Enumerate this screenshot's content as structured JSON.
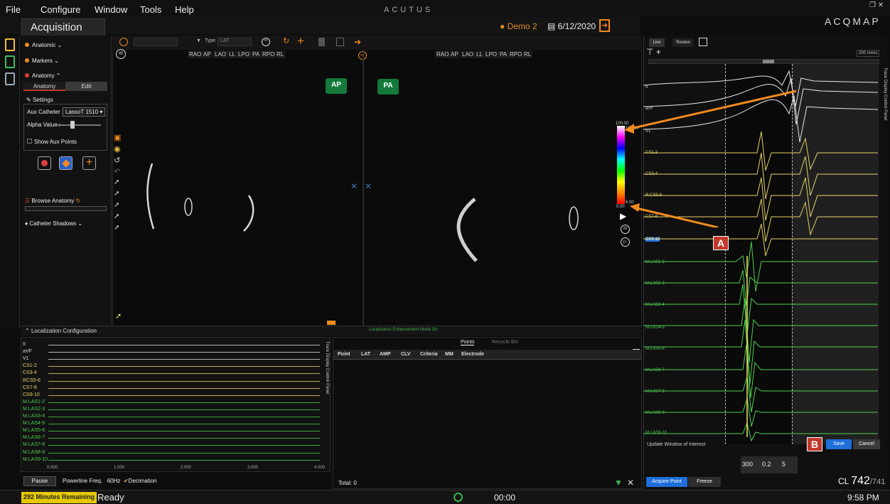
{
  "menu": {
    "items": [
      "File",
      "Configure",
      "Window",
      "Tools",
      "Help"
    ]
  },
  "brand": {
    "center": "ACUTUS",
    "right": "ACQMAP"
  },
  "window_controls": "❐ ✕",
  "header": {
    "mode_tab": "Acquisition",
    "user": "Demo 2",
    "date": "6/12/2020"
  },
  "left_panel": {
    "anatomic": "Anatomic",
    "markers": "Markers",
    "anatomy": "Anatomy",
    "segmented": [
      "Anatomy",
      "Edit"
    ],
    "settings": "Settings",
    "aux_catheter_label": "Aux Catheter :",
    "aux_catheter_value": "LassoT 1510 ▾",
    "alpha_label": "Alpha Value :",
    "alpha_level": 0.35,
    "show_aux_points": "Show Aux Points",
    "browse_anatomy": "Browse Anatomy",
    "catheter_shadows": "Catheter Shadows"
  },
  "viewport": {
    "type_label": "Type",
    "type_value": "LAT",
    "view_buttons_left": [
      "RAO",
      "AP",
      "LAO",
      "LL",
      "LPO",
      "PA",
      "RPO",
      "RL"
    ],
    "view_buttons_right": [
      "RAO",
      "AP",
      "LAO",
      "LL",
      "LPO",
      "PA",
      "RPO",
      "RL"
    ],
    "orient_left": "AP",
    "orient_right": "PA",
    "colorbar_max": "100.00",
    "colorbar_max2": "100.00",
    "colorbar_min": "0.00",
    "colorbar_min2": "6.00"
  },
  "localization": {
    "title": "Localization Configuration",
    "status": "Localization Enhancement Mode On"
  },
  "bottom_left": {
    "channels": [
      "II",
      "aVF",
      "V1",
      "CS1-2",
      "CS3-4",
      "RCS5-6",
      "CS7-8",
      "CS9-10",
      "M.LAS1-2",
      "M.LAS2-3",
      "M.LAS3-4",
      "M.LAS4-5",
      "M.LAS5-6",
      "M.LAS6-7",
      "M.LAS7-8",
      "M.LAS8-9",
      "M.LAS9-10"
    ],
    "channel_colors": [
      "#dddddd",
      "#dddddd",
      "#dddddd",
      "#e6d36a",
      "#e6d36a",
      "#e6d36a",
      "#e6d36a",
      "#e6d36a",
      "#4ccf4c",
      "#4ccf4c",
      "#4ccf4c",
      "#4ccf4c",
      "#4ccf4c",
      "#4ccf4c",
      "#4ccf4c",
      "#4ccf4c",
      "#4ccf4c"
    ],
    "axis_ticks": [
      "0.000",
      "1.000",
      "2.000",
      "3.000",
      "4.000"
    ],
    "panel_title": "Trace Display Control Panel",
    "pause": "Pause",
    "powerline_label": "Powerline Freq.",
    "powerline_value": "60Hz",
    "decimation": "Decimation"
  },
  "points": {
    "tabs": [
      "Points",
      "Recycle Bin"
    ],
    "columns": [
      "Point",
      "LAT",
      "AMP",
      "CLV",
      "Criteria",
      "MM",
      "Electrode"
    ],
    "total": "Total: 0"
  },
  "right_panel": {
    "tabs": [
      "Live",
      "Review"
    ],
    "speed": "200 mm/s",
    "channels": [
      "II",
      "aVF",
      "V1",
      "CS1-2",
      "CS3-4",
      "R:CS5-6",
      "CS7-8",
      "CS9-10",
      "M.LAS1-2",
      "M.LAS2-3",
      "M.LAS3-4",
      "M.LAS4-5",
      "M.LAS5-6",
      "M.LAS6-7",
      "M.LAS7-8",
      "M.LAS8-9",
      "M.LAS9-10"
    ],
    "channel_colors": [
      "#dddddd",
      "#dddddd",
      "#dddddd",
      "#e6d36a",
      "#e6d36a",
      "#e6d36a",
      "#e6d36a",
      "#e6d36a",
      "#4ccf4c",
      "#4ccf4c",
      "#4ccf4c",
      "#4ccf4c",
      "#4ccf4c",
      "#4ccf4c",
      "#4ccf4c",
      "#4ccf4c",
      "#4ccf4c"
    ],
    "panel_title": "Trace Display Control Panel",
    "update_window": "Update Window of Interest",
    "save": "Save",
    "cancel": "Cancel",
    "meas1": "300",
    "meas2": "0.2",
    "meas3": "5",
    "acquire_point": "Acquire Point",
    "freeze": "Freeze",
    "cl_label": "CL",
    "cl_value": "742",
    "cl_sub": "/741"
  },
  "callouts": {
    "a": "A",
    "b": "B"
  },
  "status": {
    "remaining": "292 Minutes Remaining",
    "ready": "Ready",
    "timer": "00:00",
    "clock": "9:58 PM"
  },
  "colors": {
    "accent_orange": "#f08a1e",
    "accent_blue": "#1e6fd9",
    "status_yellow": "#e6c800",
    "callout_red": "#c0392b",
    "orient_green": "#137a3b"
  }
}
